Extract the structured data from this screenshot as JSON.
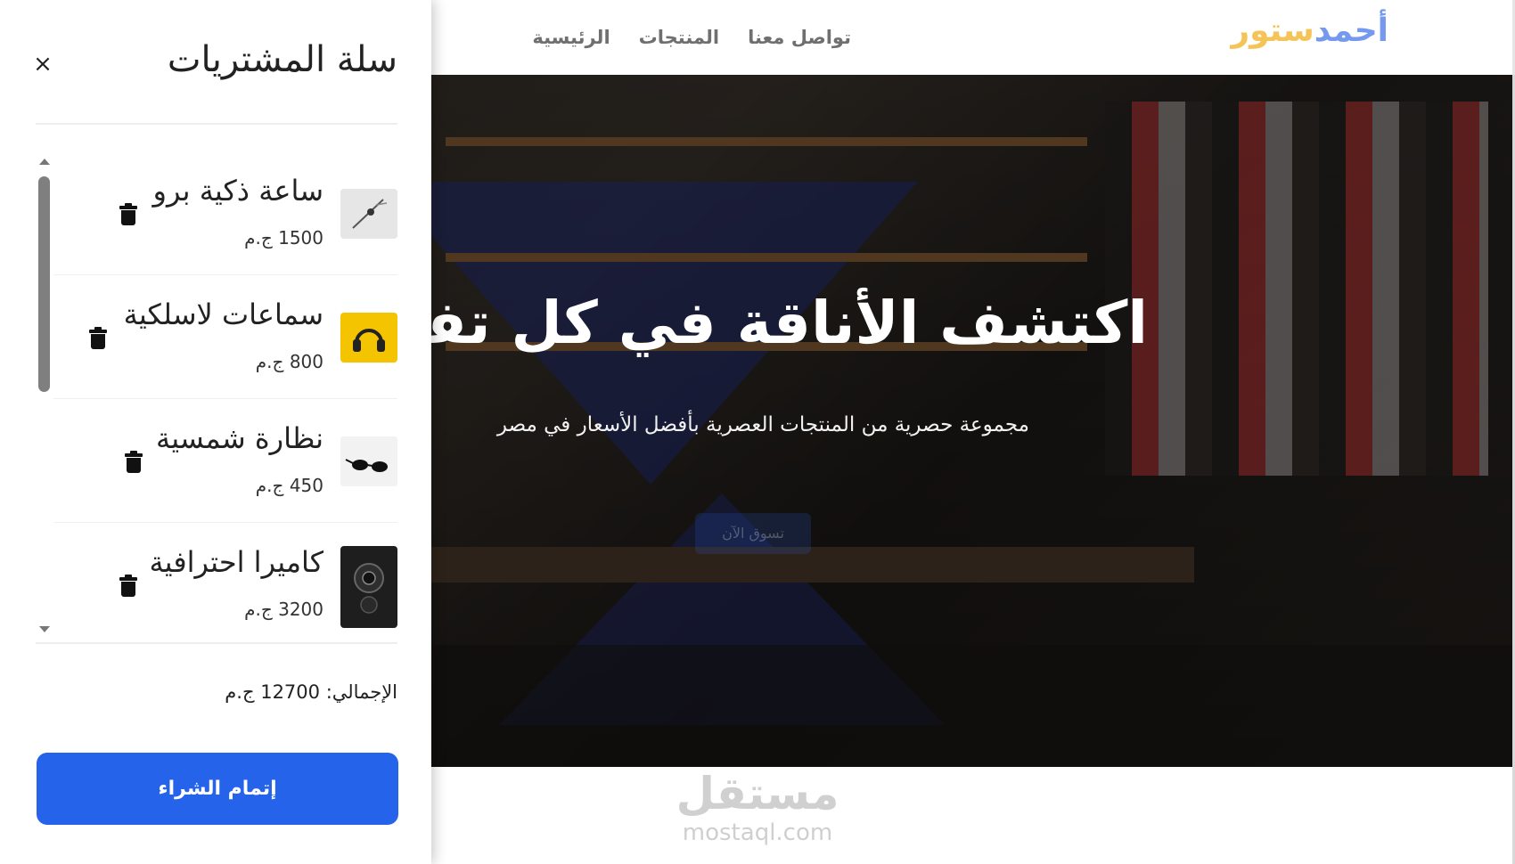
{
  "navbar": {
    "logo_part1": "أحمد",
    "logo_part2": "ستور",
    "links": [
      "الرئيسية",
      "المنتجات",
      "تواصل معنا"
    ]
  },
  "hero": {
    "title": "اكتشف الأناقة في كل تفصيلة",
    "subtitle": "مجموعة حصرية من المنتجات العصرية بأفضل الأسعار في مصر",
    "button": "تسوق الآن"
  },
  "watermark": {
    "arabic": "مستقل",
    "latin": "mostaql.com"
  },
  "cart": {
    "title": "سلة المشتريات",
    "close": "×",
    "items": [
      {
        "name": "ساعة ذكية برو",
        "price": "1500 ج.م",
        "icon": "smartwatch-thumbnail"
      },
      {
        "name": "سماعات لاسلكية",
        "price": "800 ج.م",
        "icon": "headphones-thumbnail"
      },
      {
        "name": "نظارة شمسية",
        "price": "450 ج.م",
        "icon": "sunglasses-thumbnail"
      },
      {
        "name": "كاميرا احترافية",
        "price": "3200 ج.م",
        "icon": "camera-thumbnail"
      }
    ],
    "total": "الإجمالي: 12700 ج.م",
    "checkout": "إتمام الشراء"
  },
  "colors": {
    "brand_blue": "#2563eb",
    "logo_blue": "#2a63e6",
    "logo_orange": "#f0a500"
  }
}
